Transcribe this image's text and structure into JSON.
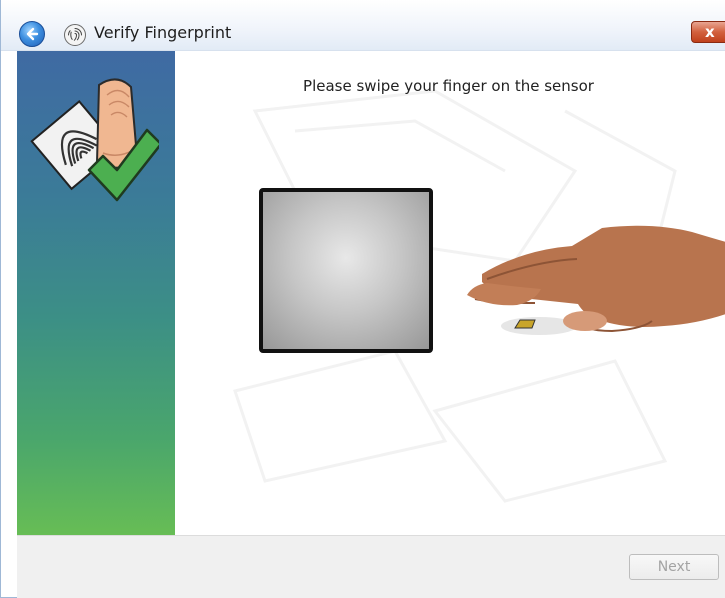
{
  "window": {
    "title": "Verify Fingerprint"
  },
  "titlebar": {
    "back_icon": "back-arrow-icon",
    "app_icon": "fingerprint-icon",
    "close_label": "x"
  },
  "content": {
    "instruction": "Please swipe your finger on the sensor"
  },
  "footer": {
    "next_label": "Next",
    "next_enabled": false
  },
  "colors": {
    "sidebar_top": "#3f6aa3",
    "sidebar_bottom": "#67bd55",
    "check_green": "#4caf50",
    "close_red": "#c0411c"
  }
}
